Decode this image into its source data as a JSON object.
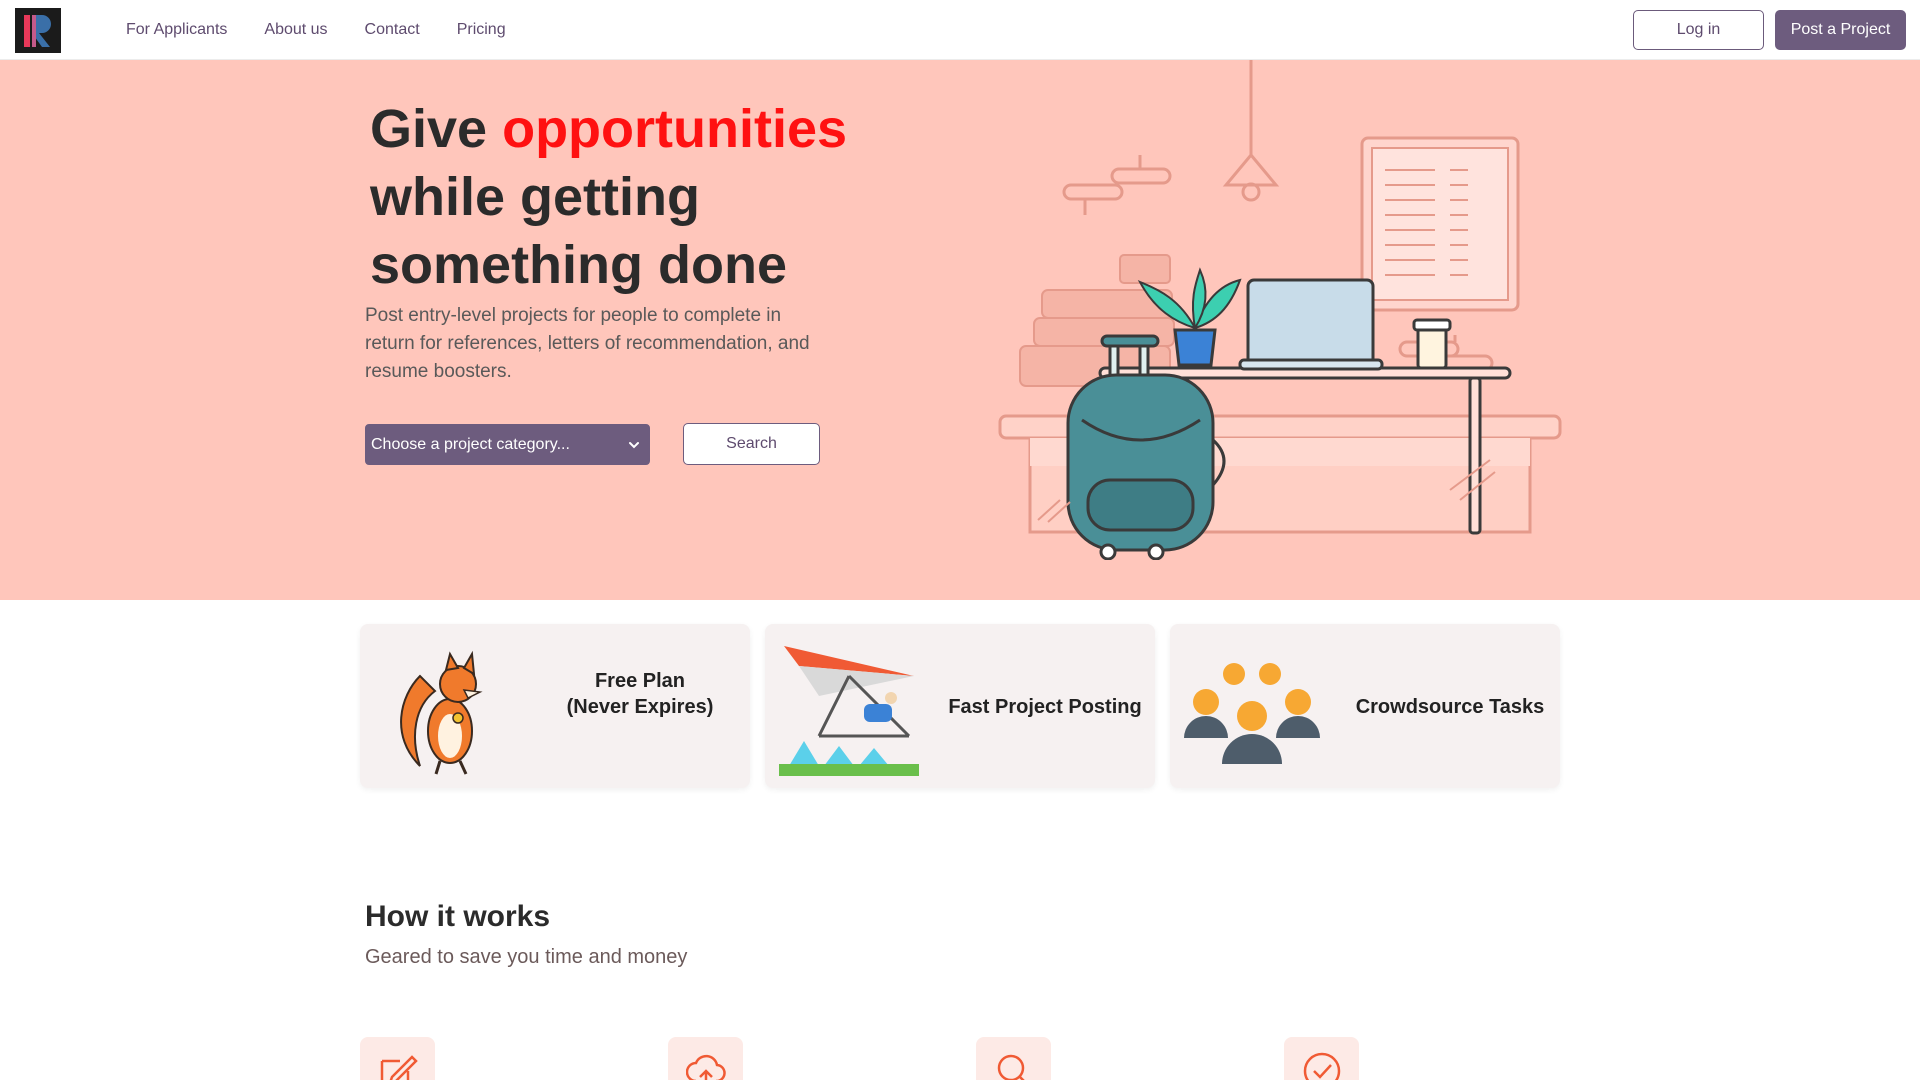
{
  "colors": {
    "brand": "#6d5c7e",
    "hero_background": "#ffc6bb",
    "accent_red": "#ff1111",
    "card_background": "#f6f1f1",
    "icon_accent": "#f05a34"
  },
  "nav": {
    "logo_icon": "brand-logo-icon",
    "links": [
      "For Applicants",
      "About us",
      "Contact",
      "Pricing"
    ],
    "login_label": "Log in",
    "post_label": "Post a Project"
  },
  "hero": {
    "title_part1": "Give ",
    "title_accent": "opportunities",
    "title_part2": " while getting something done",
    "subtitle": "Post entry-level projects for people to complete in return for references, letters of recommendation, and resume boosters.",
    "category_select": {
      "selected": "Choose a project category..."
    },
    "search_label": "Search",
    "illustration_icon": "workspace-desk-illustration"
  },
  "features": [
    {
      "label_line1": "Free Plan",
      "label_line2": "(Never Expires)",
      "icon": "fox-icon"
    },
    {
      "label_line1": "Fast Project Posting",
      "icon": "hang-glider-icon"
    },
    {
      "label_line1": "Crowdsource Tasks",
      "icon": "people-group-icon"
    }
  ],
  "how_it_works": {
    "title": "How it works",
    "subtitle": "Geared to save you time and money",
    "steps": [
      {
        "icon": "edit-icon"
      },
      {
        "icon": "cloud-upload-icon"
      },
      {
        "icon": "search-icon"
      },
      {
        "icon": "check-circle-icon"
      }
    ]
  }
}
